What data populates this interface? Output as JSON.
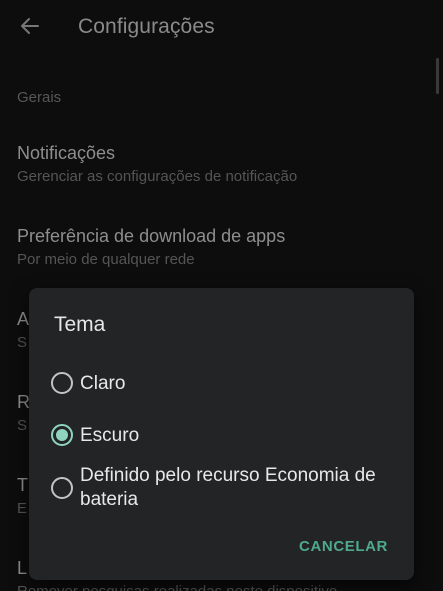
{
  "header": {
    "title": "Configurações",
    "back_icon": "arrow-left-icon"
  },
  "section": {
    "label": "Gerais"
  },
  "rows": [
    {
      "title": "Notificações",
      "subtitle": "Gerenciar as configurações de notificação"
    },
    {
      "title": "Preferência de download de apps",
      "subtitle": "Por meio de qualquer rede"
    },
    {
      "title": "A",
      "subtitle": "S"
    },
    {
      "title": "R",
      "subtitle": "S"
    },
    {
      "title": "T",
      "subtitle": "E"
    },
    {
      "title": "L",
      "subtitle": "Remover pesquisas realizadas neste dispositivo"
    }
  ],
  "dialog": {
    "title": "Tema",
    "options": [
      {
        "label": "Claro",
        "selected": false
      },
      {
        "label": "Escuro",
        "selected": true
      },
      {
        "label": "Definido pelo recurso Economia de bateria",
        "selected": false
      }
    ],
    "cancel_label": "CANCELAR"
  },
  "colors": {
    "accent": "#8fd4bd",
    "button_text": "#4fa98c",
    "dialog_bg": "#222426",
    "screen_bg": "#0d0d0d"
  }
}
